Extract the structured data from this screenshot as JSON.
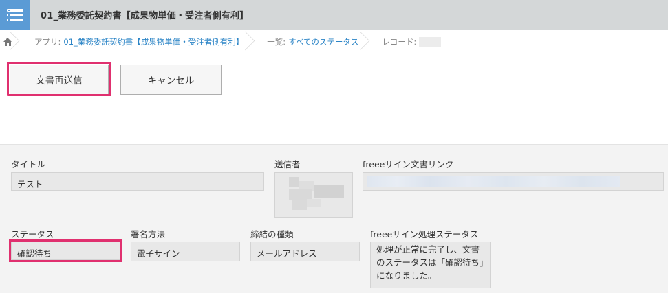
{
  "header": {
    "title": "01_業務委託契約書【成果物単価・受注者側有利】"
  },
  "breadcrumb": {
    "app_prefix": "アプリ:",
    "app_name": "01_業務委託契約書【成果物単価・受注者側有利】",
    "list_prefix": "一覧:",
    "list_name": "すべてのステータス",
    "record_prefix": "レコード:"
  },
  "buttons": {
    "resend": "文書再送信",
    "cancel": "キャンセル"
  },
  "fields": {
    "title": {
      "label": "タイトル",
      "value": "テスト"
    },
    "sender": {
      "label": "送信者"
    },
    "freee_link": {
      "label": "freeeサイン文書リンク"
    },
    "status": {
      "label": "ステータス",
      "value": "確認待ち"
    },
    "sign_method": {
      "label": "署名方法",
      "value": "電子サイン"
    },
    "contract_type": {
      "label": "締結の種類",
      "value": "メールアドレス"
    },
    "freee_status": {
      "label": "freeeサイン処理ステータス",
      "value": "処理が正常に完了し、文書のステータスは「確認待ち」になりました。"
    }
  },
  "colors": {
    "accent_highlight": "#e0306f",
    "link": "#2b84c6",
    "app_icon": "#5b9bd5"
  },
  "icons": {
    "app": "list-icon",
    "home": "home-icon"
  }
}
